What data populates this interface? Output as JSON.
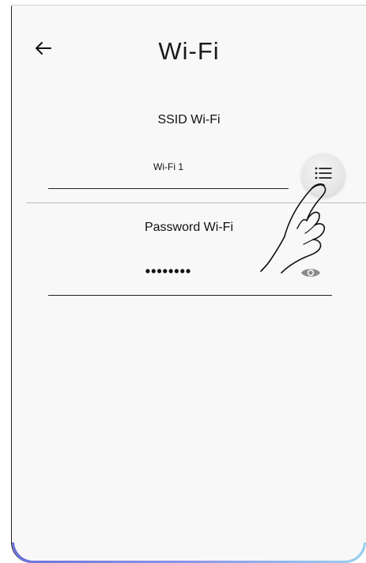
{
  "header": {
    "title": "Wi-Fi",
    "back_icon": "arrow-left-icon"
  },
  "ssid": {
    "label": "SSID Wi-Fi",
    "value": "Wi-Fi 1",
    "list_icon": "list-icon"
  },
  "password": {
    "label": "Password Wi-Fi",
    "value": "••••••••",
    "visibility_icon": "eye-icon"
  },
  "overlay": {
    "gesture_icon": "tap-hand-icon"
  },
  "colors": {
    "background": "#f8f8f8",
    "text": "#111111",
    "button_bg": "#e4e4e4",
    "eye_icon": "#8a8a8a",
    "bottom_accent": "#7b84e0"
  }
}
